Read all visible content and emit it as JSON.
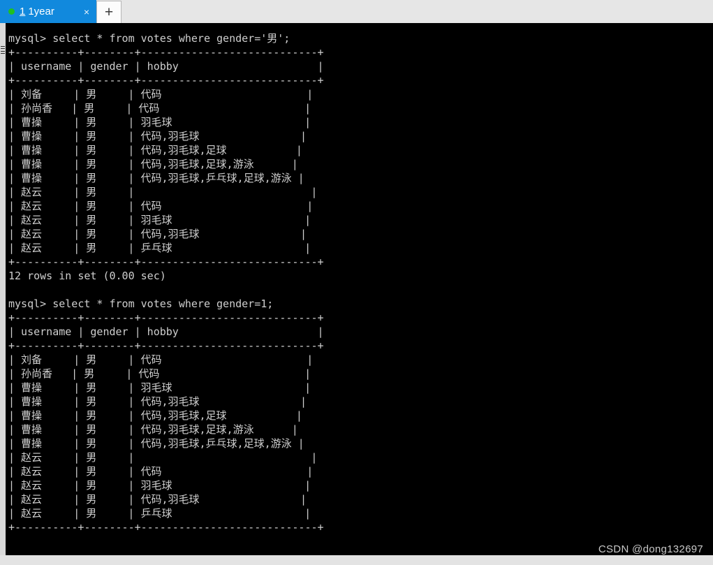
{
  "window": {
    "type": "terminal-emulator",
    "background_color": "#000000",
    "text_color": "#cfcfcf",
    "chrome_color": "#e6e6e6"
  },
  "tabbar": {
    "active_tab": {
      "index": "1",
      "title": "1year",
      "status_dot_color": "#20c020",
      "close_label": "×",
      "accent_color": "#1189dd"
    },
    "new_tab_label": "+"
  },
  "watermark": "CSDN @dong132697",
  "terminal": {
    "prompt": "mysql>",
    "border_top_1": "+----------+--------+----------------------------+",
    "table": {
      "columns": [
        "username",
        "gender",
        "hobby"
      ],
      "header_line": "| username | gender | hobby                      |",
      "separator_line": "+----------+--------+----------------------------+",
      "rows": [
        {
          "username": "刘备",
          "gender": "男",
          "hobby": "代码"
        },
        {
          "username": "孙尚香",
          "gender": "男",
          "hobby": "代码"
        },
        {
          "username": "曹操",
          "gender": "男",
          "hobby": "羽毛球"
        },
        {
          "username": "曹操",
          "gender": "男",
          "hobby": "代码,羽毛球"
        },
        {
          "username": "曹操",
          "gender": "男",
          "hobby": "代码,羽毛球,足球"
        },
        {
          "username": "曹操",
          "gender": "男",
          "hobby": "代码,羽毛球,足球,游泳"
        },
        {
          "username": "曹操",
          "gender": "男",
          "hobby": "代码,羽毛球,乒乓球,足球,游泳"
        },
        {
          "username": "赵云",
          "gender": "男",
          "hobby": ""
        },
        {
          "username": "赵云",
          "gender": "男",
          "hobby": "代码"
        },
        {
          "username": "赵云",
          "gender": "男",
          "hobby": "羽毛球"
        },
        {
          "username": "赵云",
          "gender": "男",
          "hobby": "代码,羽毛球"
        },
        {
          "username": "赵云",
          "gender": "男",
          "hobby": "乒乓球"
        }
      ]
    },
    "blocks": [
      {
        "command": "mysql> select * from votes where gender='男';",
        "result_status": "12 rows in set (0.00 sec)",
        "has_status": true
      },
      {
        "command": "mysql> select * from votes where gender=1;",
        "result_status": "",
        "has_status": false
      }
    ]
  }
}
